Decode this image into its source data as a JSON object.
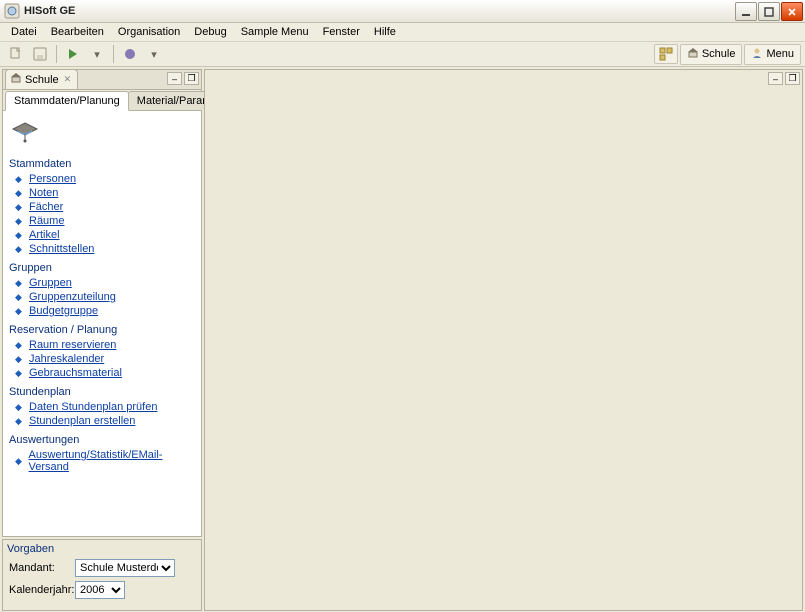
{
  "app": {
    "title": "HISoft GE"
  },
  "menubar": [
    "Datei",
    "Bearbeiten",
    "Organisation",
    "Debug",
    "Sample Menu",
    "Fenster",
    "Hilfe"
  ],
  "toolbar_right": {
    "perspective_schule": "Schule",
    "perspective_menu": "Menu"
  },
  "view_tab": {
    "label": "Schule"
  },
  "inner_tabs": [
    "Stammdaten/Planung",
    "Material/Parameter"
  ],
  "sections": [
    {
      "title": "Stammdaten",
      "links": [
        "Personen",
        "Noten",
        "Fächer",
        "Räume",
        "Artikel",
        "Schnittstellen"
      ]
    },
    {
      "title": "Gruppen",
      "links": [
        "Gruppen",
        "Gruppenzuteilung",
        "Budgetgruppe"
      ]
    },
    {
      "title": "Reservation / Planung",
      "links": [
        "Raum reservieren",
        "Jahreskalender",
        "Gebrauchsmaterial"
      ]
    },
    {
      "title": "Stundenplan",
      "links": [
        "Daten Stundenplan prüfen",
        "Stundenplan erstellen"
      ]
    },
    {
      "title": "Auswertungen",
      "links": [
        "Auswertung/Statistik/EMail-Versand"
      ]
    }
  ],
  "vorgaben": {
    "title": "Vorgaben",
    "mandant_label": "Mandant:",
    "mandant_value": "Schule Musterdorf",
    "kalender_label": "Kalenderjahr:",
    "kalender_value": "2006"
  }
}
